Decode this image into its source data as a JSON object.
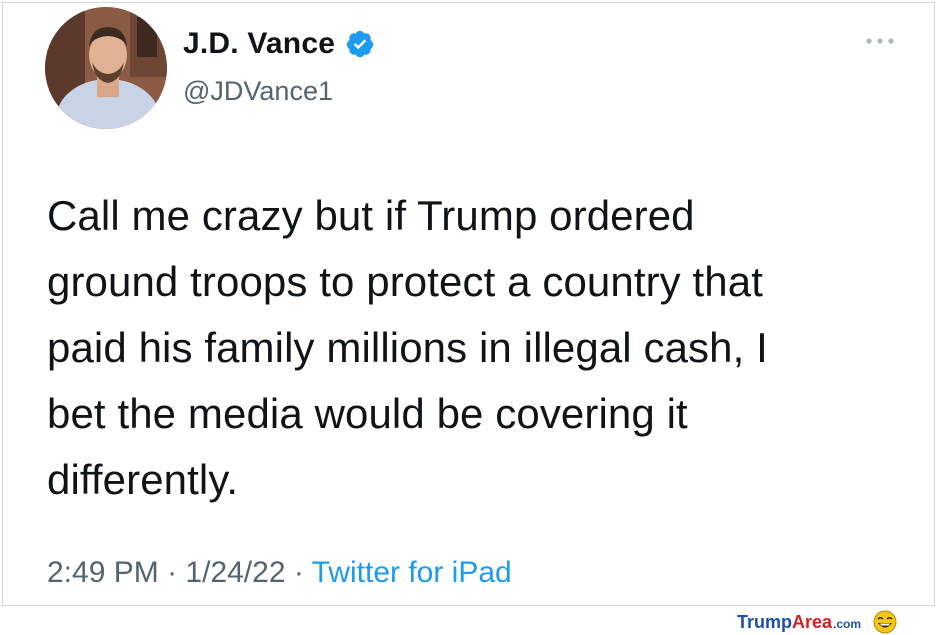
{
  "tweet": {
    "author": {
      "display_name": "J.D. Vance",
      "handle": "@JDVance1",
      "verified": true,
      "verified_color": "#1d9bf0"
    },
    "text_lines": [
      "Call me crazy but if Trump ordered",
      "ground troops to protect a country that",
      "paid his family millions in illegal cash, I",
      "bet the media would be covering it",
      "differently."
    ],
    "time": "2:49 PM",
    "separator": "·",
    "date": "1/24/22",
    "source": "Twitter for iPad",
    "more_icon": "more-horizontal-icon"
  },
  "watermark": {
    "part1": "Trump",
    "part2": "Area",
    "part3": ".com",
    "icon": "laughing-face-icon"
  },
  "colors": {
    "text": "#0f1419",
    "secondary": "#536471",
    "link": "#1d9bf0",
    "border": "#cfd9de"
  }
}
